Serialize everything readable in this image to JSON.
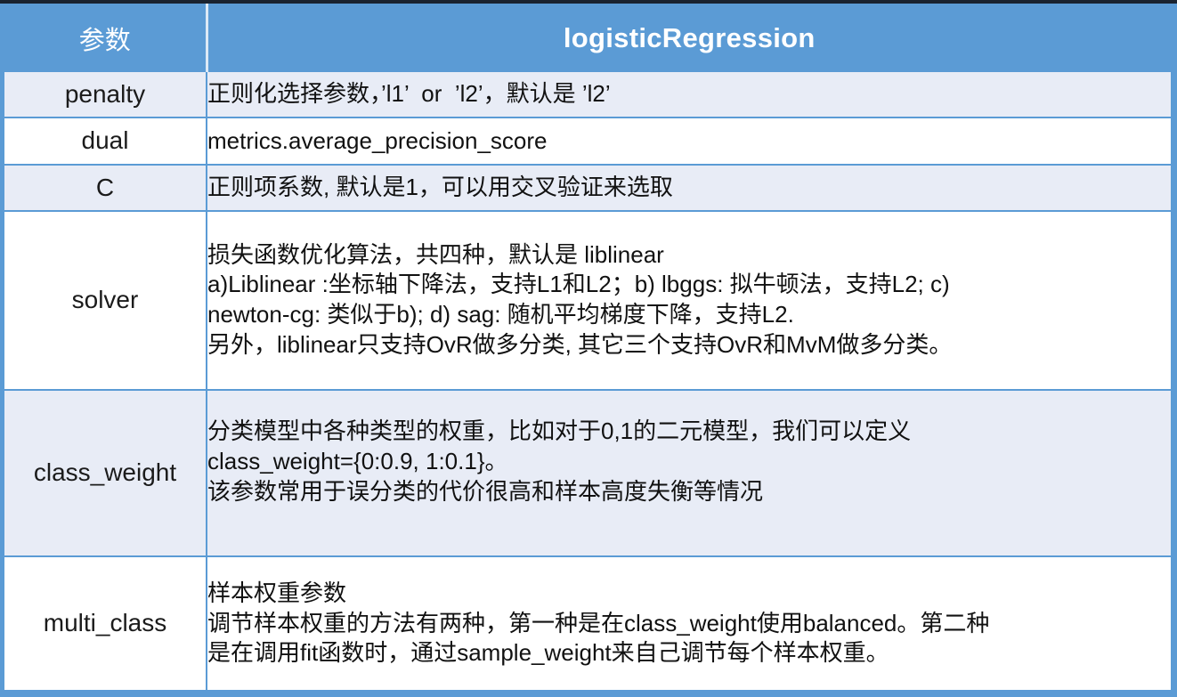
{
  "table": {
    "header": {
      "param_column": "参数",
      "value_column": "logisticRegression"
    },
    "rows": [
      {
        "name": "penalty",
        "lines": [
          "正则化选择参数，’l1’  or  ’l2’，默认是 ’l2’"
        ]
      },
      {
        "name": "dual",
        "lines": [
          "metrics.average_precision_score"
        ]
      },
      {
        "name": "C",
        "lines": [
          "正则项系数, 默认是1，可以用交叉验证来选取"
        ]
      },
      {
        "name": "solver",
        "lines": [
          "损失函数优化算法，共四种，默认是 liblinear",
          "a)Liblinear :坐标轴下降法，支持L1和L2；b) lbggs: 拟牛顿法，支持L2; c)",
          "newton-cg: 类似于b); d) sag: 随机平均梯度下降，支持L2.",
          "另外，liblinear只支持OvR做多分类, 其它三个支持OvR和MvM做多分类。"
        ]
      },
      {
        "name": "class_weight",
        "lines": [
          "分类模型中各种类型的权重，比如对于0,1的二元模型，我们可以定义",
          "class_weight={0:0.9, 1:0.1}。",
          "该参数常用于误分类的代价很高和样本高度失衡等情况",
          ""
        ]
      },
      {
        "name": "multi_class",
        "lines": [
          "样本权重参数",
          "调节样本权重的方法有两种，第一种是在class_weight使用balanced。第二种",
          "是在调用fit函数时，通过sample_weight来自己调节每个样本权重。"
        ]
      }
    ]
  },
  "colors": {
    "header_blue": "#5b9bd5",
    "row_shade": "#e8ecf6",
    "row_plain": "#ffffff",
    "border": "#5b9bd5",
    "header_text": "#ffffff",
    "body_text": "#111111",
    "top_strip": "#1a2330"
  }
}
